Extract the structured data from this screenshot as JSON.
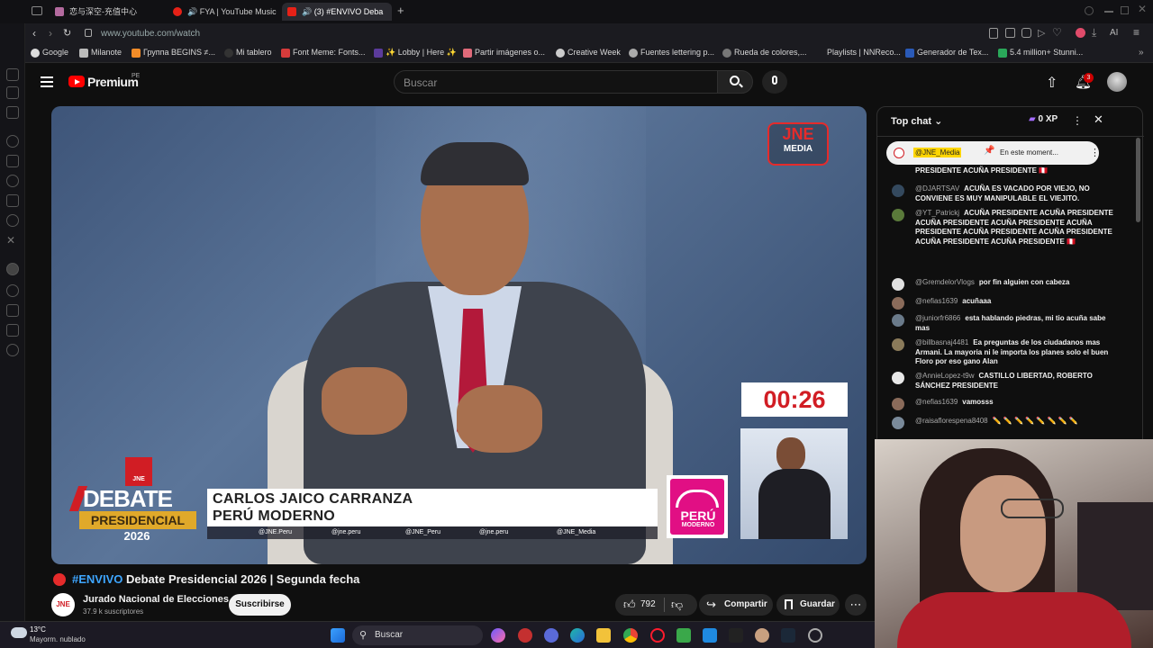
{
  "tabs": [
    {
      "label": "恋与深空-充值中心"
    },
    {
      "label": "FYA | YouTube Music"
    },
    {
      "label": "(3) #ENVIVO Deba"
    }
  ],
  "address": {
    "url": "www.youtube.com/watch"
  },
  "toolbar_right": {
    "ai_label": "AI"
  },
  "bookmarks": [
    {
      "label": "Google"
    },
    {
      "label": "Milanote"
    },
    {
      "label": "Группа BEGINS ≠..."
    },
    {
      "label": "Mi tablero"
    },
    {
      "label": "Font Meme: Fonts..."
    },
    {
      "label": "✨ Lobby | Here ✨"
    },
    {
      "label": "Partir imágenes o..."
    },
    {
      "label": "Creative Week"
    },
    {
      "label": "Fuentes lettering p..."
    },
    {
      "label": "Rueda de colores,..."
    },
    {
      "label": "Playlists | NNReco..."
    },
    {
      "label": "Generador de Tex..."
    },
    {
      "label": "5.4 million+ Stunni..."
    }
  ],
  "yt": {
    "logo": "Premium",
    "logo_region": "PE",
    "search_placeholder": "Buscar",
    "notif_count": "3"
  },
  "video": {
    "brand": "JNE",
    "brand_sub": "MEDIA",
    "timer": "00:26",
    "candidate_name": "CARLOS JAICO CARRANZA",
    "candidate_party": "PERÚ MODERNO",
    "debate_line1": "DEBATE",
    "debate_line2": "PRESIDENCIAL",
    "debate_year": "2026",
    "party_logo_line1": "PERÚ",
    "party_logo_line2": "MODERNO",
    "socials": [
      "@JNE.Peru",
      "@jne.peru",
      "@JNE_Peru",
      "@jne.peru",
      "@JNE_Media"
    ]
  },
  "meta": {
    "live_tag": "#ENVIVO",
    "title": "Debate Presidencial 2026 | Segunda fecha",
    "channel": "Jurado Nacional de Elecciones",
    "channel_logo": "JNE",
    "subs": "37.9 k suscriptores",
    "subscribe": "Suscribirse",
    "likes": "792",
    "share": "Compartir",
    "save": "Guardar"
  },
  "chat": {
    "header": "Top chat",
    "xp": "0 XP",
    "pinned_user": "@JNE_Media",
    "pinned_text": "En este moment...",
    "messages": [
      {
        "user": "",
        "text": "PRESIDENTE ACUÑA PRESIDENTE 🇵🇪",
        "color": "#c0392b"
      },
      {
        "user": "@DJARTSAV",
        "text": "ACUÑA ES VACADO POR VIEJO, NO CONVIENE ES MUY MANIPULABLE EL VIEJITO.",
        "color": "#34495e"
      },
      {
        "user": "@YT_Patrickj",
        "text": "ACUÑA PRESIDENTE ACUÑA PRESIDENTE ACUÑA PRESIDENTE ACUÑA PRESIDENTE ACUÑA PRESIDENTE ACUÑA PRESIDENTE ACUÑA PRESIDENTE ACUÑA PRESIDENTE ACUÑA PRESIDENTE 🇵🇪",
        "color": "#5a7a3a"
      },
      {
        "user": "@GremdelorVlogs",
        "text": "por fin alguien con cabeza",
        "color": "#e0e0e0"
      },
      {
        "user": "@nefias1639",
        "text": "acuñaaa",
        "color": "#8a6b5a"
      },
      {
        "user": "@juniorfr6866",
        "text": "esta hablando piedras, mi tio acuña sabe mas",
        "color": "#6a7a8a"
      },
      {
        "user": "@billbasnaj4481",
        "text": "Ea preguntas de los ciudadanos mas Armani. La mayoria ni le importa los planes solo el buen Floro por eso gano Alan",
        "color": "#8a7a5a"
      },
      {
        "user": "@AnnieLopez-t9w",
        "text": "CASTILLO LIBERTAD, ROBERTO SÁNCHEZ PRESIDENTE",
        "color": "#e8e8e8"
      },
      {
        "user": "@nefias1639",
        "text": "vamosss",
        "color": "#8a6b5a"
      },
      {
        "user": "@raisaflorespena8408",
        "text": "✏️ ✏️ ✏️ ✏️ ✏️ ✏️ ✏️ ✏️",
        "color": "#7a8a9a"
      }
    ]
  },
  "taskbar": {
    "temp": "13°C",
    "weather": "Mayorm. nublado",
    "search": "Buscar"
  }
}
